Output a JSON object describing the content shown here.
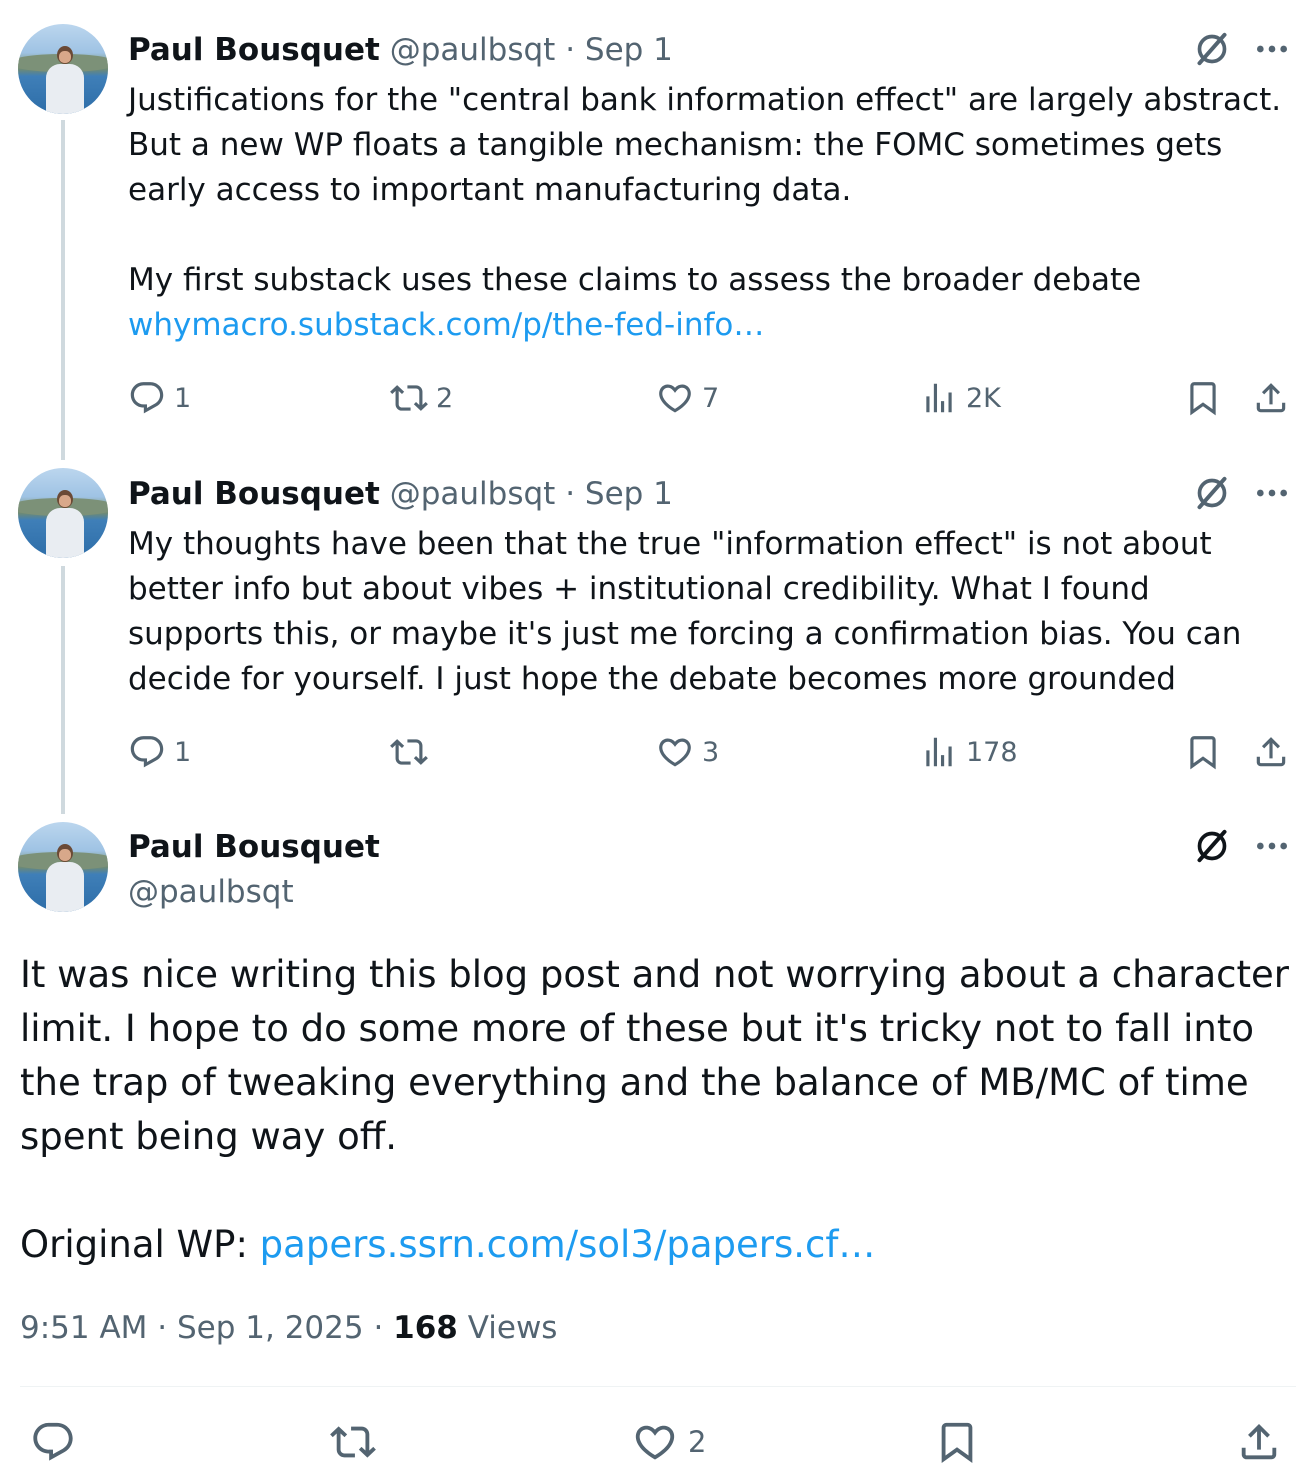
{
  "thread": [
    {
      "author": {
        "name": "Paul Bousquet",
        "handle": "@paulbsqt",
        "date": "· Sep 1"
      },
      "paragraph1": "Justifications for the \"central bank information effect\" are largely abstract. But a new WP floats a tangible mechanism: the FOMC sometimes gets early access to important manufacturing data.",
      "paragraph2": "My first substack uses these claims to assess the broader debate",
      "link": "whymacro.substack.com/p/the-fed-info…",
      "stats": {
        "replies": "1",
        "reposts": "2",
        "likes": "7",
        "views": "2K"
      }
    },
    {
      "author": {
        "name": "Paul Bousquet",
        "handle": "@paulbsqt",
        "date": "· Sep 1"
      },
      "paragraph1": "My thoughts have been that the true \"information effect\" is not about better info but about vibes + institutional credibility. What I found supports this, or maybe it's just me forcing a confirmation bias. You can decide for yourself. I just hope the debate becomes more grounded",
      "stats": {
        "replies": "1",
        "reposts": "",
        "likes": "3",
        "views": "178"
      }
    }
  ],
  "main": {
    "author": {
      "name": "Paul Bousquet",
      "handle": "@paulbsqt"
    },
    "paragraph1": "It was nice writing this blog post and not worrying about a character limit. I hope to do some more of these but it's tricky not to fall into the trap of tweaking everything and the balance of MB/MC of time spent being way off.",
    "original_label": "Original WP: ",
    "link": "papers.ssrn.com/sol3/papers.cf…",
    "time": "9:51 AM",
    "date": "Sep 1, 2025",
    "sep": " · ",
    "views_count": "168",
    "views_label": "Views",
    "stats": {
      "likes": "2"
    }
  },
  "icons": {
    "grok": "grok-icon",
    "more": "more-icon",
    "reply": "reply-icon",
    "repost": "repost-icon",
    "like": "like-icon",
    "views": "views-icon",
    "bookmark": "bookmark-icon",
    "share": "share-icon"
  },
  "colors": {
    "link": "#1d9bf0",
    "secondary": "#536471",
    "text": "#0f1419",
    "thread_line": "#cfd9de"
  }
}
